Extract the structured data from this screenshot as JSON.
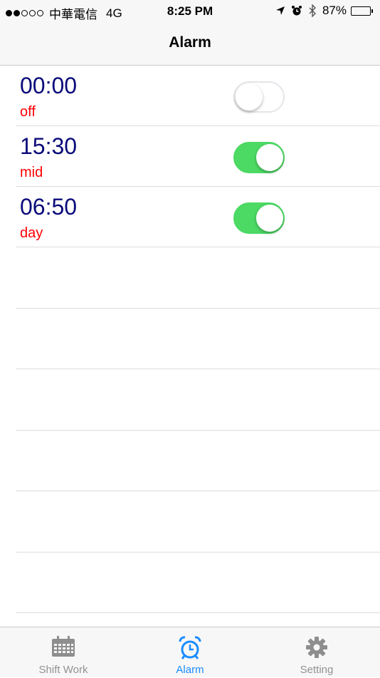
{
  "status_bar": {
    "carrier": "中華電信",
    "network": "4G",
    "time": "8:25 PM",
    "battery_percent": "87%",
    "battery_level": 0.87,
    "signal_bars_filled": 2,
    "signal_bars_total": 5,
    "icons": [
      "location-arrow-icon",
      "alarm-clock-icon",
      "bluetooth-icon",
      "battery-icon"
    ]
  },
  "nav": {
    "title": "Alarm"
  },
  "alarms": [
    {
      "time": "00:00",
      "label": "off",
      "enabled": false
    },
    {
      "time": "15:30",
      "label": "mid",
      "enabled": true
    },
    {
      "time": "06:50",
      "label": "day",
      "enabled": true
    }
  ],
  "empty_rows": 6,
  "tabs": [
    {
      "label": "Shift Work",
      "icon": "calendar-icon",
      "active": false
    },
    {
      "label": "Alarm",
      "icon": "alarm-clock-icon",
      "active": true
    },
    {
      "label": "Setting",
      "icon": "gear-icon",
      "active": false
    }
  ],
  "colors": {
    "time_text": "#0b0b7a",
    "label_text": "#ff0000",
    "toggle_on": "#4cd964",
    "tab_active": "#1a8cff",
    "tab_inactive": "#929292"
  }
}
